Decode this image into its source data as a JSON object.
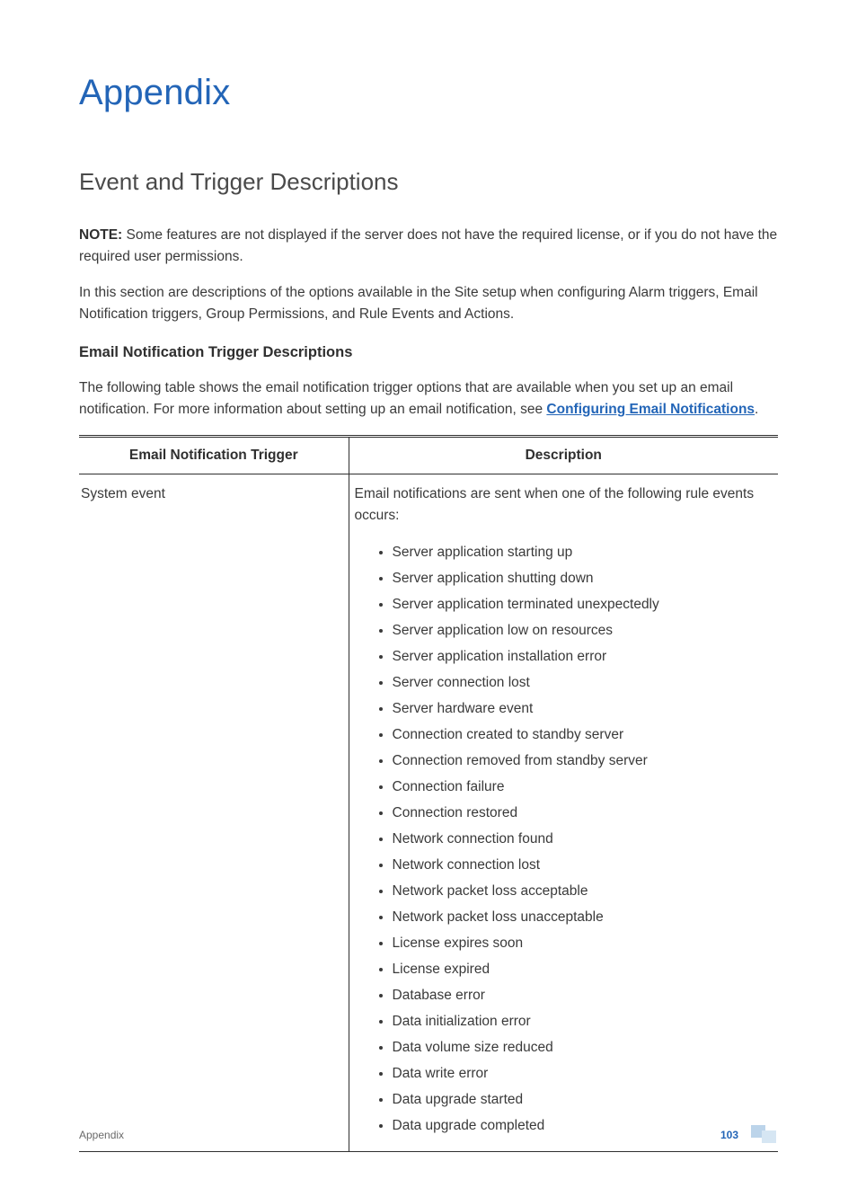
{
  "title": "Appendix",
  "section_heading": "Event and Trigger Descriptions",
  "note": {
    "label": "NOTE:",
    "text": " Some features are not displayed if the server does not have the required license, or if you do not have the required user permissions."
  },
  "intro_paragraph": "In this section are descriptions of the options available in the Site setup when configuring Alarm triggers, Email Notification triggers, Group Permissions, and Rule Events and Actions.",
  "subsection_heading": "Email Notification Trigger Descriptions",
  "subsection_intro_leading": "The following table shows the email notification trigger options that are available when you set up an email notification. For more information about setting up an email notification, see ",
  "subsection_intro_link": "Configuring Email Notifications",
  "subsection_intro_trailing": ".",
  "table": {
    "headers": {
      "trigger": "Email Notification Trigger",
      "description": "Description"
    },
    "rows": [
      {
        "trigger": "System event",
        "description_lead": "Email notifications are sent when one of the following rule events occurs:",
        "events": [
          "Server application starting up",
          "Server application shutting down",
          "Server application terminated unexpectedly",
          "Server application low on resources",
          "Server application installation error",
          "Server connection lost",
          "Server hardware event",
          "Connection created to standby server",
          "Connection removed from standby server",
          "Connection failure",
          "Connection restored",
          "Network connection found",
          "Network connection lost",
          "Network packet loss acceptable",
          "Network packet loss unacceptable",
          "License expires soon",
          "License expired",
          "Database error",
          "Data initialization error",
          "Data volume size reduced",
          "Data write error",
          "Data upgrade started",
          "Data upgrade completed"
        ]
      }
    ]
  },
  "footer": {
    "label": "Appendix",
    "page_number": "103"
  }
}
